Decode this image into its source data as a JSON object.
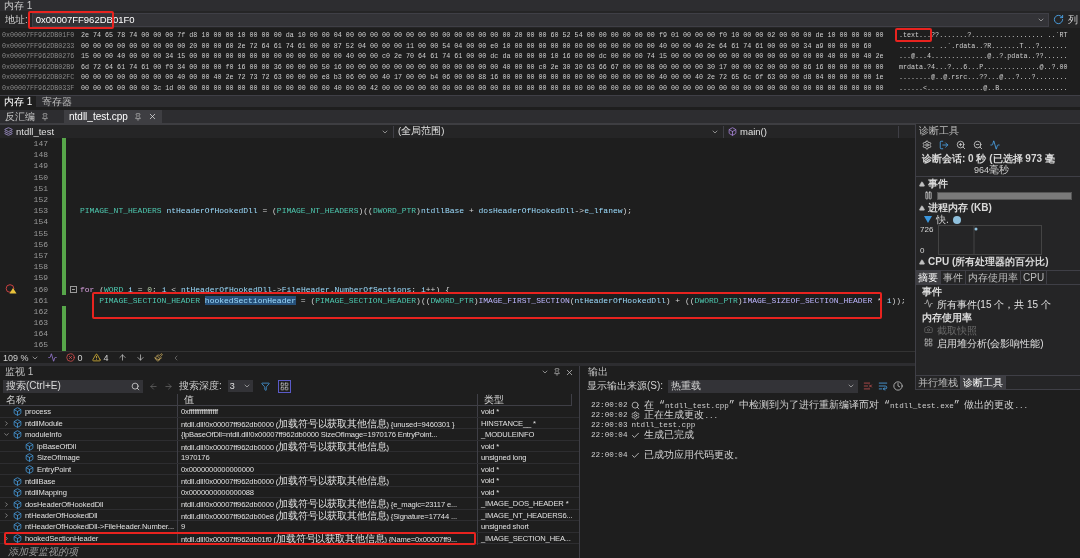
{
  "memory": {
    "title": "内存 1",
    "address_label": "地址:",
    "address": "0x00007FF962DB01F0",
    "highlighted": true,
    "column_label": "列",
    "rows": [
      {
        "address": "0x00007FF962DB01F0",
        "bytes": "2e 74 65 78 74 00 00 00 7f d8 10 00 00 10 00 00 00 da 10 00 00 04 00 00 00 00 00 00 00 00 00 00 00 00 00 00 20 00 00 60 52 54 00 00 00 00 00 00 f9 01 00 00 00 f0 10 00 00 02 00 00 00 de 10 00 00 00 00",
        "ascii": ".text...??.......?.................. ..`RT",
        "ascii_highlighted": true
      },
      {
        "address": "0x00007FF962DB0233",
        "bytes": "00 00 00 00 00 00 00 00 00 20 00 00 60 2e 72 64 61 74 61 00 00 87 52 04 00 00 00 11 00 00 54 04 00 00 e0 10 00 00 00 00 00 00 00 00 00 00 00 00 40 00 00 40 2e 64 61 74 61 00 00 00 34 a9 00 00 00 60",
        "ascii": "......... ..`.rdata..?R.......T...?.......",
        "ascii_highlighted": false
      },
      {
        "address": "0x00007FF962DB0276",
        "bytes": "15 00 00 40 00 00 00 34 15 00 00 00 00 00 00 00 00 00 00 00 00 00 40 00 00 c0 2e 70 64 61 74 61 00 00 dc da 00 00 00 10 16 00 00 dc 00 00 00 74 15 00 00 00 00 00 00 00 00 00 00 00 00 00 40 00 00 40 2e",
        "ascii": "...@...4..............@..?.pdata..??......",
        "ascii_highlighted": false
      },
      {
        "address": "0x00007FF962DB02B9",
        "bytes": "6d 72 64 61 74 61 00 f0 34 00 00 00 f0 16 00 00 36 00 00 00 50 16 00 00 00 00 00 00 00 00 00 00 00 00 00 40 00 00 c0 2e 30 30 63 66 67 00 00 08 00 00 00 00 30 17 00 00 02 00 00 00 86 16 00 00 00 00 00",
        "ascii": "mrdata.?4...?...6...P..............@..?.00",
        "ascii_highlighted": false
      },
      {
        "address": "0x00007FF962DB02FC",
        "bytes": "00 00 00 00 00 00 00 00 40 00 00 40 2e 72 73 72 63 00 00 00 e8 b3 06 00 00 40 17 00 00 b4 06 00 00 88 16 00 00 00 00 00 00 00 00 00 00 00 00 00 40 00 00 40 2e 72 65 6c 6f 63 00 00 d8 04 00 00 00 00 1e",
        "ascii": "........@..@.rsrc...??...@...?...?........",
        "ascii_highlighted": false
      },
      {
        "address": "0x00007FF962DB033F",
        "bytes": "00 00 06 00 00 00 3c 1d 00 00 00 00 00 00 00 00 00 00 00 00 00 40 00 00 42 00 00 00 00 00 00 00 00 00 00 00 00 00 00 00 00 00 00 00 00 00 00 00 00 00 00 00 00 00 00 00 00 00 00 00 00 00 00 00 00 00 00",
        "ascii": "......<..............@..B.................",
        "ascii_highlighted": false
      }
    ],
    "tabs": [
      {
        "label": "内存 1",
        "selected": true
      },
      {
        "label": "寄存器",
        "selected": false
      }
    ]
  },
  "document_tabs": [
    {
      "label": "反汇编",
      "selected": false,
      "closable": false
    },
    {
      "label": "ntdll_test.cpp",
      "selected": true,
      "closable": true
    }
  ],
  "navigation": {
    "project": "ntdll_test",
    "scope": "(全局范围)",
    "function": "main()"
  },
  "editor": {
    "lines": [
      {
        "number": "147",
        "changed": true,
        "highlighted": false
      },
      {
        "number": "148",
        "changed": true,
        "highlighted": false
      },
      {
        "number": "149",
        "changed": true,
        "highlighted": false
      },
      {
        "number": "150",
        "changed": true,
        "highlighted": false
      },
      {
        "number": "151",
        "changed": true,
        "highlighted": false
      },
      {
        "number": "152",
        "changed": true,
        "highlighted": false
      },
      {
        "number": "153",
        "changed": true,
        "highlighted": false,
        "tokens": [
          {
            "kind": "type",
            "text": "PIMAGE_NT_HEADERS "
          },
          {
            "kind": "var",
            "text": "ntHeaderOfHookedDll"
          },
          {
            "kind": "plain",
            "text": " = ("
          },
          {
            "kind": "type",
            "text": "PIMAGE_NT_HEADERS"
          },
          {
            "kind": "plain",
            "text": ")(("
          },
          {
            "kind": "type",
            "text": "DWORD_PTR"
          },
          {
            "kind": "plain",
            "text": ")"
          },
          {
            "kind": "var",
            "text": "ntdllBase"
          },
          {
            "kind": "plain",
            "text": " + "
          },
          {
            "kind": "var",
            "text": "dosHeaderOfHookedDll"
          },
          {
            "kind": "plain",
            "text": "->"
          },
          {
            "kind": "var",
            "text": "e_lfanew"
          },
          {
            "kind": "plain",
            "text": ");"
          }
        ]
      },
      {
        "number": "154",
        "changed": true,
        "highlighted": false
      },
      {
        "number": "155",
        "changed": true,
        "highlighted": false
      },
      {
        "number": "156",
        "changed": true,
        "highlighted": false
      },
      {
        "number": "157",
        "changed": true,
        "highlighted": false
      },
      {
        "number": "158",
        "changed": true,
        "highlighted": false
      },
      {
        "number": "159",
        "changed": true,
        "highlighted": false
      },
      {
        "number": "160",
        "changed": true,
        "highlighted": false,
        "breakpoint_warning": true,
        "collapsible": true,
        "tokens": [
          {
            "kind": "keyword",
            "text": "for"
          },
          {
            "kind": "plain",
            "text": " ("
          },
          {
            "kind": "type",
            "text": "WORD "
          },
          {
            "kind": "var",
            "text": "i"
          },
          {
            "kind": "plain",
            "text": " = "
          },
          {
            "kind": "number",
            "text": "0"
          },
          {
            "kind": "plain",
            "text": "; "
          },
          {
            "kind": "var",
            "text": "i"
          },
          {
            "kind": "plain",
            "text": " < "
          },
          {
            "kind": "var",
            "text": "ntHeaderOfHookedDll"
          },
          {
            "kind": "plain",
            "text": "->"
          },
          {
            "kind": "var",
            "text": "FileHeader"
          },
          {
            "kind": "plain",
            "text": "."
          },
          {
            "kind": "var",
            "text": "NumberOfSections"
          },
          {
            "kind": "plain",
            "text": "; "
          },
          {
            "kind": "var",
            "text": "i"
          },
          {
            "kind": "plain",
            "text": "++) {"
          }
        ]
      },
      {
        "number": "161",
        "changed": false,
        "highlighted": true,
        "tokens": [
          {
            "kind": "type",
            "text": "    PIMAGE_SECTION_HEADER "
          },
          {
            "kind": "selection",
            "text": "hookedSectionHeader"
          },
          {
            "kind": "plain",
            "text": " = ("
          },
          {
            "kind": "type",
            "text": "PIMAGE_SECTION_HEADER"
          },
          {
            "kind": "plain",
            "text": ")(("
          },
          {
            "kind": "type",
            "text": "DWORD_PTR"
          },
          {
            "kind": "plain",
            "text": ")"
          },
          {
            "kind": "macro",
            "text": "IMAGE_FIRST_SECTION"
          },
          {
            "kind": "plain",
            "text": "("
          },
          {
            "kind": "var",
            "text": "ntHeaderOfHookedDll"
          },
          {
            "kind": "plain",
            "text": ") + (("
          },
          {
            "kind": "type",
            "text": "DWORD_PTR"
          },
          {
            "kind": "plain",
            "text": ")"
          },
          {
            "kind": "macro",
            "text": "IMAGE_SIZEOF_SECTION_HEADER"
          },
          {
            "kind": "plain",
            "text": " * "
          },
          {
            "kind": "var",
            "text": "i"
          },
          {
            "kind": "plain",
            "text": "));"
          }
        ]
      },
      {
        "number": "162",
        "changed": true,
        "highlighted": false
      },
      {
        "number": "163",
        "changed": true,
        "highlighted": false
      },
      {
        "number": "164",
        "changed": true,
        "highlighted": false
      },
      {
        "number": "165",
        "changed": true,
        "highlighted": false
      }
    ],
    "status": {
      "zoom": "109 %",
      "errors": "0",
      "warnings": "4"
    }
  },
  "diagnostics": {
    "title": "诊断工具",
    "session": "诊断会话: 0 秒 (已选择 973 毫",
    "timeline_label": "964毫秒",
    "events_heading": "事件",
    "memory_heading": "进程内存 (KB)",
    "snapshot_legend": "快.",
    "memory_axis": [
      "726",
      "0"
    ],
    "cpu_heading": "CPU (所有处理器的百分比)",
    "tabs": [
      {
        "label": "摘要",
        "selected": true
      },
      {
        "label": "事件",
        "selected": false
      },
      {
        "label": "内存使用率",
        "selected": false
      },
      {
        "label": "CPU",
        "selected": false
      }
    ],
    "summary_events_heading": "事件",
    "all_events": "所有事件(15 个，共 15 个",
    "memory_usage_heading": "内存使用率",
    "actions": [
      {
        "label": "截取快照",
        "disabled": true
      },
      {
        "label": "启用堆分析(会影响性能)",
        "disabled": false
      }
    ],
    "bottom_tabs": [
      {
        "label": "并行堆栈",
        "selected": false
      },
      {
        "label": "诊断工具",
        "selected": true
      }
    ]
  },
  "watch": {
    "title": "监视 1",
    "search_placeholder": "搜索(Ctrl+E)",
    "depth_label": "搜索深度:",
    "depth": "3",
    "columns": [
      "名称",
      "值",
      "类型"
    ],
    "rows": [
      {
        "name": "process",
        "value": "0xffffffffffffffff",
        "type": "void *",
        "highlighted": false
      },
      {
        "name": "ntdllModule",
        "value": "ntdll.dll!0x00007ff962db0000 (加载符号以获取其他信息) {unused=9460301 }",
        "type": "HINSTANCE__ *",
        "expanded": false,
        "highlighted": false
      },
      {
        "name": "moduleInfo",
        "value": "{lpBaseOfDll=ntdll.dll!0x00007ff962db0000 SizeOfImage=1970176 EntryPoint...",
        "type": "_MODULEINFO",
        "expanded": true,
        "highlighted": false,
        "children": [
          {
            "name": "lpBaseOfDll",
            "value": "ntdll.dll!0x00007ff962db0000 (加载符号以获取其他信息)",
            "type": "void *",
            "highlighted": false
          },
          {
            "name": "SizeOfImage",
            "value": "1970176",
            "type": "unsigned long",
            "highlighted": false
          },
          {
            "name": "EntryPoint",
            "value": "0x0000000000000000",
            "type": "void *",
            "highlighted": false
          }
        ]
      },
      {
        "name": "ntdllBase",
        "value": "ntdll.dll!0x00007ff962db0000 (加载符号以获取其他信息)",
        "type": "void *",
        "highlighted": false
      },
      {
        "name": "ntdllMapping",
        "value": "0x0000000000000088",
        "type": "void *",
        "highlighted": false
      },
      {
        "name": "dosHeaderOfHookedDll",
        "value": "ntdll.dll!0x00007ff962db0000 (加载符号以获取其他信息) {e_magic=23117 e...",
        "type": "_IMAGE_DOS_HEADER *",
        "expanded": false,
        "highlighted": false
      },
      {
        "name": "ntHeaderOfHookedDll",
        "value": "ntdll.dll!0x00007ff962db00e8 (加载符号以获取其他信息) {Signature=17744 ...",
        "type": "_IMAGE_NT_HEADERS6...",
        "expanded": false,
        "highlighted": false
      },
      {
        "name": "ntHeaderOfHookedDll->FileHeader.Number...",
        "value": "9",
        "type": "unsigned short",
        "highlighted": false
      },
      {
        "name": "hookedSectionHeader",
        "value": "ntdll.dll!0x00007ff962db01f0 (加载符号以获取其他信息) {Name=0x00007ff9...",
        "type": "_IMAGE_SECTION_HEA...",
        "expanded": false,
        "highlighted": true
      }
    ],
    "add_placeholder": "添加要监视的项"
  },
  "output": {
    "title": "输出",
    "source_label": "显示输出来源(S):",
    "source": "热重载",
    "lines": [
      {
        "time": "22:00:02",
        "kind": "detect",
        "text": "在 “ntdll_test.cpp” 中检测到为了进行重新编译而对 “ntdll_test.exe” 做出的更改..."
      },
      {
        "time": "22:00:02",
        "kind": "build",
        "text": "正在生成更改..."
      },
      {
        "time": "22:00:03",
        "kind": "file",
        "text": "ntdll_test.cpp"
      },
      {
        "time": "22:00:04",
        "kind": "done",
        "text": "生成已完成"
      },
      {
        "kind": "blank"
      },
      {
        "time": "22:00:04",
        "kind": "done",
        "text": "已成功应用代码更改。"
      }
    ]
  }
}
